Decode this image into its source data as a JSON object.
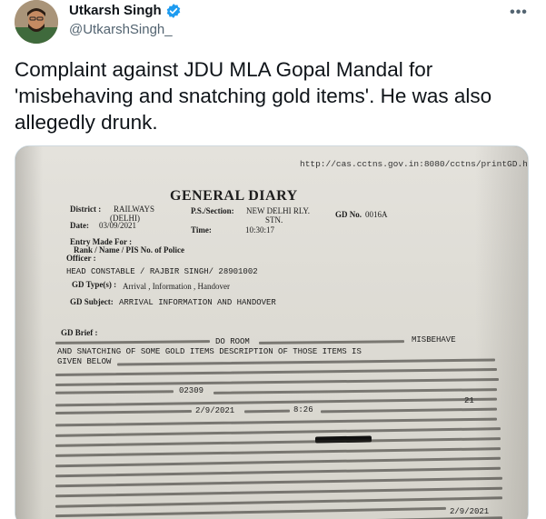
{
  "author": {
    "display_name": "Utkarsh Singh",
    "handle": "@UtkarshSingh_",
    "verified": true,
    "avatar_icon": "user-avatar-photo"
  },
  "menu": {
    "more_label": "•••",
    "more_icon": "more-horizontal-icon"
  },
  "tweet": {
    "text_line1": "Complaint against JDU MLA Gopal Mandal for",
    "text_line2": "'misbehaving and snatching gold items'. He was also",
    "text_line3": "allegedly drunk."
  },
  "document": {
    "url": "http://cas.cctns.gov.in:8080/cctns/printGD.htm...",
    "title": "GENERAL DIARY",
    "district_label": "District :",
    "district_value": "RAILWAYS",
    "district_sub": "(DELHI)",
    "ps_label": "P.S./Section:",
    "ps_value": "NEW DELHI RLY.",
    "ps_sub": "STN.",
    "gd_no_label": "GD No.",
    "gd_no_value": "0016A",
    "date_label": "Date:",
    "date_value": "03/09/2021",
    "time_label": "Time:",
    "time_value": "10:30:17",
    "entry_made_for": "Entry Made For :",
    "rank_label": "Rank / Name / PIS No. of Police",
    "officer_label": "Officer :",
    "officer_value": "HEAD CONSTABLE / RAJBIR SINGH/ 28901002",
    "gd_type_label": "GD Type(s) :",
    "gd_type_value": "Arrival , Information , Handover",
    "gd_subject_label": "GD Subject:",
    "gd_subject_value": "ARRIVAL INFORMATION AND HANDOVER",
    "gd_brief_label": "GD Brief :",
    "brief_en1": "DO ROOM",
    "brief_en2": "MISBEHAVE",
    "brief_en3": "AND SNATCHING OF SOME GOLD ITEMS DESCRIPTION OF THOSE ITEMS IS",
    "brief_en4": "GIVEN BELOW",
    "brief_num1": "02309",
    "brief_num2": "2/9/2021",
    "brief_num3": "8:26",
    "brief_num4": "21",
    "brief_num5": "2/9/2021"
  }
}
